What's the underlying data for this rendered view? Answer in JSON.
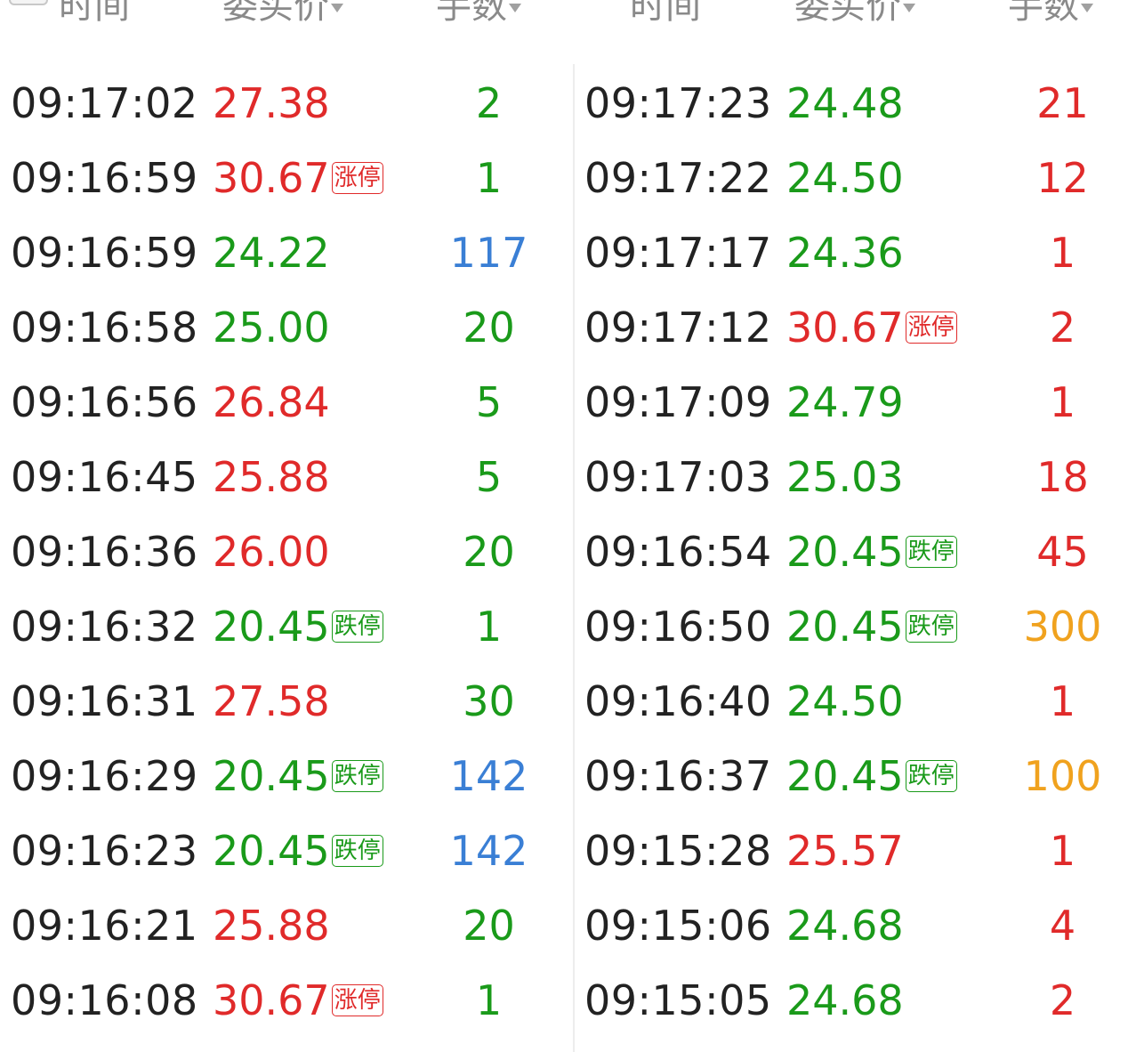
{
  "header": {
    "left": {
      "time": "时间",
      "price": "委买价",
      "volume": "手数"
    },
    "right": {
      "time": "时间",
      "price": "委买价",
      "volume": "手数"
    }
  },
  "colors": {
    "up": "#e02a2a",
    "down": "#1a9a1a",
    "blue": "#3a7fd5",
    "orange": "#f0a21e",
    "time": "#222222"
  },
  "left_rows": [
    {
      "time": "09:17:02",
      "price": "27.38",
      "price_color": "up",
      "badge": "",
      "volume": "2",
      "volume_color": "down"
    },
    {
      "time": "09:16:59",
      "price": "30.67",
      "price_color": "up",
      "badge": "涨停",
      "volume": "1",
      "volume_color": "down"
    },
    {
      "time": "09:16:59",
      "price": "24.22",
      "price_color": "down",
      "badge": "",
      "volume": "117",
      "volume_color": "blue"
    },
    {
      "time": "09:16:58",
      "price": "25.00",
      "price_color": "down",
      "badge": "",
      "volume": "20",
      "volume_color": "down"
    },
    {
      "time": "09:16:56",
      "price": "26.84",
      "price_color": "up",
      "badge": "",
      "volume": "5",
      "volume_color": "down"
    },
    {
      "time": "09:16:45",
      "price": "25.88",
      "price_color": "up",
      "badge": "",
      "volume": "5",
      "volume_color": "down"
    },
    {
      "time": "09:16:36",
      "price": "26.00",
      "price_color": "up",
      "badge": "",
      "volume": "20",
      "volume_color": "down"
    },
    {
      "time": "09:16:32",
      "price": "20.45",
      "price_color": "down",
      "badge": "跌停",
      "volume": "1",
      "volume_color": "down"
    },
    {
      "time": "09:16:31",
      "price": "27.58",
      "price_color": "up",
      "badge": "",
      "volume": "30",
      "volume_color": "down"
    },
    {
      "time": "09:16:29",
      "price": "20.45",
      "price_color": "down",
      "badge": "跌停",
      "volume": "142",
      "volume_color": "blue"
    },
    {
      "time": "09:16:23",
      "price": "20.45",
      "price_color": "down",
      "badge": "跌停",
      "volume": "142",
      "volume_color": "blue"
    },
    {
      "time": "09:16:21",
      "price": "25.88",
      "price_color": "up",
      "badge": "",
      "volume": "20",
      "volume_color": "down"
    },
    {
      "time": "09:16:08",
      "price": "30.67",
      "price_color": "up",
      "badge": "涨停",
      "volume": "1",
      "volume_color": "down"
    }
  ],
  "right_rows": [
    {
      "time": "09:17:23",
      "price": "24.48",
      "price_color": "down",
      "badge": "",
      "volume": "21",
      "volume_color": "up"
    },
    {
      "time": "09:17:22",
      "price": "24.50",
      "price_color": "down",
      "badge": "",
      "volume": "12",
      "volume_color": "up"
    },
    {
      "time": "09:17:17",
      "price": "24.36",
      "price_color": "down",
      "badge": "",
      "volume": "1",
      "volume_color": "up"
    },
    {
      "time": "09:17:12",
      "price": "30.67",
      "price_color": "up",
      "badge": "涨停",
      "volume": "2",
      "volume_color": "up"
    },
    {
      "time": "09:17:09",
      "price": "24.79",
      "price_color": "down",
      "badge": "",
      "volume": "1",
      "volume_color": "up"
    },
    {
      "time": "09:17:03",
      "price": "25.03",
      "price_color": "down",
      "badge": "",
      "volume": "18",
      "volume_color": "up"
    },
    {
      "time": "09:16:54",
      "price": "20.45",
      "price_color": "down",
      "badge": "跌停",
      "volume": "45",
      "volume_color": "up"
    },
    {
      "time": "09:16:50",
      "price": "20.45",
      "price_color": "down",
      "badge": "跌停",
      "volume": "300",
      "volume_color": "orange"
    },
    {
      "time": "09:16:40",
      "price": "24.50",
      "price_color": "down",
      "badge": "",
      "volume": "1",
      "volume_color": "up"
    },
    {
      "time": "09:16:37",
      "price": "20.45",
      "price_color": "down",
      "badge": "跌停",
      "volume": "100",
      "volume_color": "orange"
    },
    {
      "time": "09:15:28",
      "price": "25.57",
      "price_color": "up",
      "badge": "",
      "volume": "1",
      "volume_color": "up"
    },
    {
      "time": "09:15:06",
      "price": "24.68",
      "price_color": "down",
      "badge": "",
      "volume": "4",
      "volume_color": "up"
    },
    {
      "time": "09:15:05",
      "price": "24.68",
      "price_color": "down",
      "badge": "",
      "volume": "2",
      "volume_color": "up"
    }
  ]
}
